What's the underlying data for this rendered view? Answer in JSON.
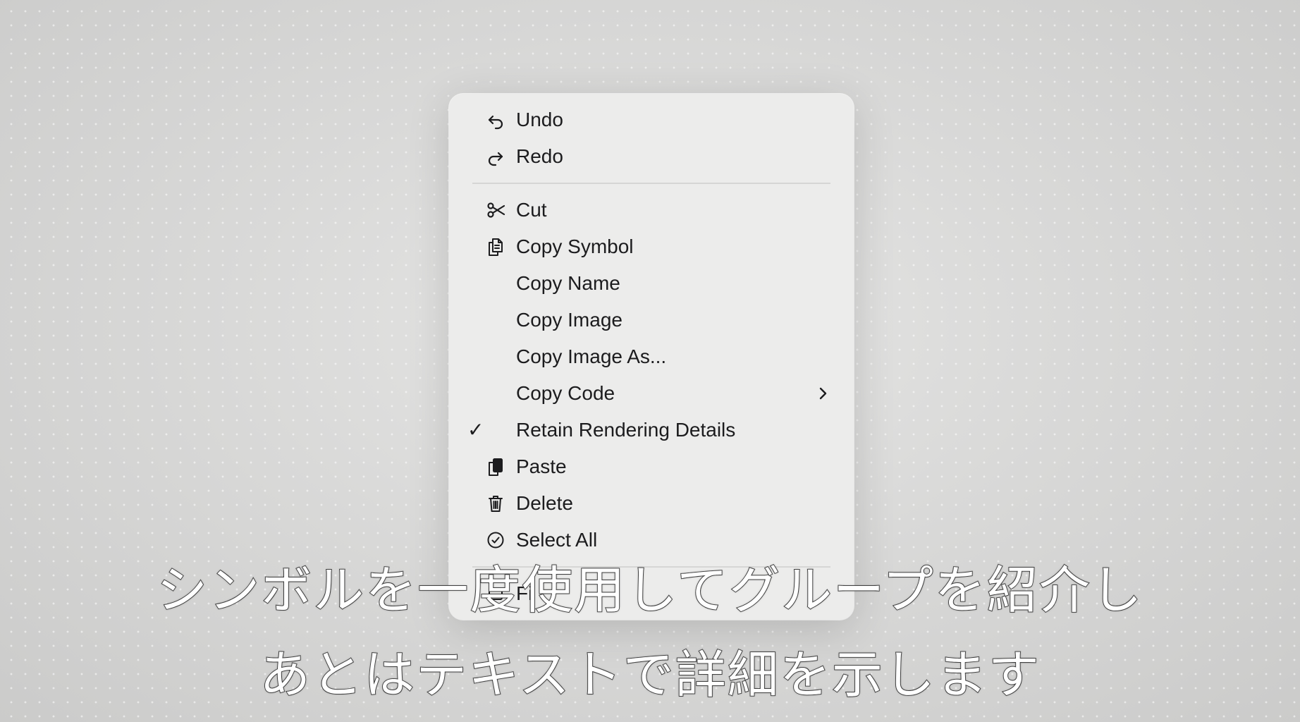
{
  "context_menu": {
    "items": [
      {
        "label": "Undo",
        "icon": "undo-icon"
      },
      {
        "label": "Redo",
        "icon": "redo-icon"
      },
      {
        "label": "Cut",
        "icon": "scissors-icon"
      },
      {
        "label": "Copy Symbol",
        "icon": "copy-symbol-icon"
      },
      {
        "label": "Copy Name"
      },
      {
        "label": "Copy Image"
      },
      {
        "label": "Copy Image As..."
      },
      {
        "label": "Copy Code",
        "submenu": true,
        "icon_right": "chevron-right-icon"
      },
      {
        "label": "Retain Rendering Details",
        "checked": true,
        "check_glyph": "✓"
      },
      {
        "label": "Paste",
        "icon": "paste-icon"
      },
      {
        "label": "Delete",
        "icon": "trash-icon"
      },
      {
        "label": "Select All",
        "icon": "checkmark-circle-icon"
      },
      {
        "label": "Fi",
        "partially_hidden": true
      }
    ]
  },
  "subtitles": {
    "line1": "シンボルを一度使用してグループを紹介し",
    "line2": "あとはテキストで詳細を示します"
  }
}
